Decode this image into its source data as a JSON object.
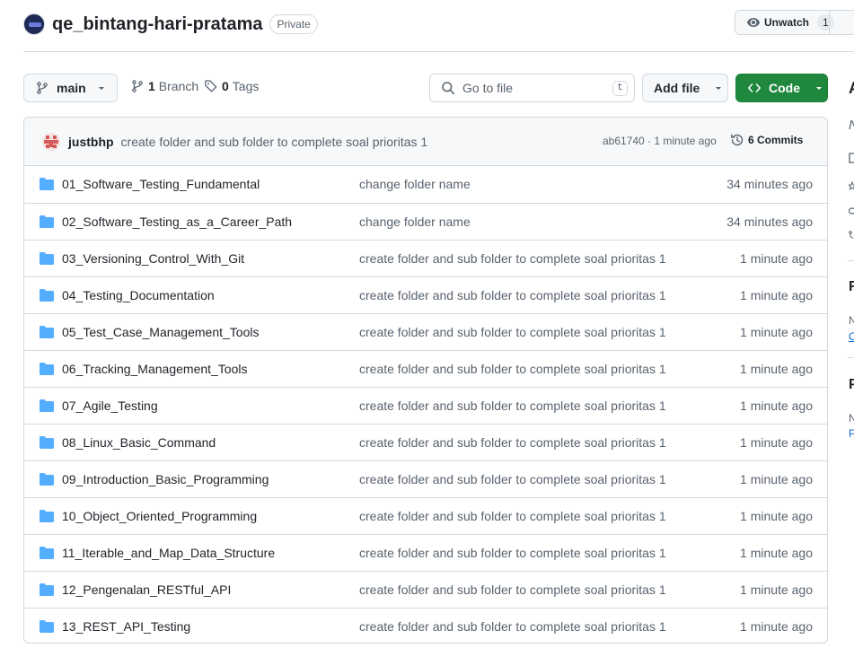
{
  "repo": {
    "name": "qe_bintang-hari-pratama",
    "visibility": "Private",
    "watch_label": "Unwatch",
    "watch_count": "1"
  },
  "toolbar": {
    "branch_name": "main",
    "branch_count": "1",
    "branch_label": "Branch",
    "tag_count": "0",
    "tag_label": "Tags",
    "goto_placeholder": "Go to file",
    "goto_shortcut": "t",
    "add_file_label": "Add file",
    "code_label": "Code"
  },
  "latest_commit": {
    "author": "justbhp",
    "message": "create folder and sub folder to complete soal prioritas 1",
    "meta": "ab61740 · 1 minute ago",
    "commits_count_label": "6 Commits"
  },
  "files": [
    {
      "name": "01_Software_Testing_Fundamental",
      "commit": "change folder name",
      "time": "34 minutes ago"
    },
    {
      "name": "02_Software_Testing_as_a_Career_Path",
      "commit": "change folder name",
      "time": "34 minutes ago"
    },
    {
      "name": "03_Versioning_Control_With_Git",
      "commit": "create folder and sub folder to complete soal prioritas 1",
      "time": "1 minute ago"
    },
    {
      "name": "04_Testing_Documentation",
      "commit": "create folder and sub folder to complete soal prioritas 1",
      "time": "1 minute ago"
    },
    {
      "name": "05_Test_Case_Management_Tools",
      "commit": "create folder and sub folder to complete soal prioritas 1",
      "time": "1 minute ago"
    },
    {
      "name": "06_Tracking_Management_Tools",
      "commit": "create folder and sub folder to complete soal prioritas 1",
      "time": "1 minute ago"
    },
    {
      "name": "07_Agile_Testing",
      "commit": "create folder and sub folder to complete soal prioritas 1",
      "time": "1 minute ago"
    },
    {
      "name": "08_Linux_Basic_Command",
      "commit": "create folder and sub folder to complete soal prioritas 1",
      "time": "1 minute ago"
    },
    {
      "name": "09_Introduction_Basic_Programming",
      "commit": "create folder and sub folder to complete soal prioritas 1",
      "time": "1 minute ago"
    },
    {
      "name": "10_Object_Oriented_Programming",
      "commit": "create folder and sub folder to complete soal prioritas 1",
      "time": "1 minute ago"
    },
    {
      "name": "11_Iterable_and_Map_Data_Structure",
      "commit": "create folder and sub folder to complete soal prioritas 1",
      "time": "1 minute ago"
    },
    {
      "name": "12_Pengenalan_RESTful_API",
      "commit": "create folder and sub folder to complete soal prioritas 1",
      "time": "1 minute ago"
    },
    {
      "name": "13_REST_API_Testing",
      "commit": "create folder and sub folder to complete soal prioritas 1",
      "time": "1 minute ago"
    }
  ],
  "sidebar_clipped": {
    "about_initial": "A",
    "line2": "N",
    "section1_initial": "R",
    "section1_sub": "N",
    "section1_link": "C",
    "section2_initial": "P",
    "section2_sub": "N",
    "section2_link": "P"
  },
  "colors": {
    "accent_green": "#1f883d",
    "folder_blue": "#54aeff",
    "border": "#d1d9e0",
    "muted_text": "#59636e",
    "link_blue": "#0969da"
  }
}
